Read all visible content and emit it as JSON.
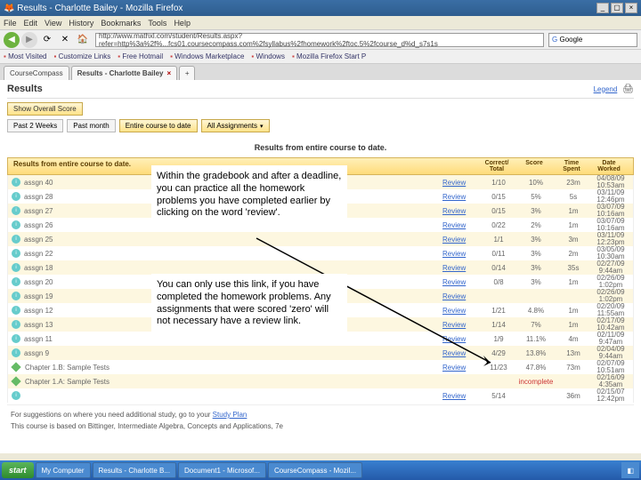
{
  "window": {
    "title": "Results - Charlotte Bailey - Mozilla Firefox"
  },
  "menu": [
    "File",
    "Edit",
    "View",
    "History",
    "Bookmarks",
    "Tools",
    "Help"
  ],
  "url": "http://www.mathxl.com/student/Results.aspx?refer=http%3a%2f%...fcs01.coursecompass.com%2fsyllabus%2fhomework%2ftoc.5%2fcourse_d%d_s7s1s",
  "search_placeholder": "Google",
  "bookmarks": [
    "Most Visited",
    "Customize Links",
    "Free Hotmail",
    "Windows Marketplace",
    "Windows",
    "Mozilla Firefox Start P"
  ],
  "tabs": [
    {
      "label": "CourseCompass"
    },
    {
      "label": "Results - Charlotte Bailey",
      "active": true
    }
  ],
  "page": {
    "heading": "Results",
    "legend": "Legend",
    "score_btn": "Show Overall Score",
    "filters": [
      {
        "label": "Past 2 Weeks"
      },
      {
        "label": "Past month"
      },
      {
        "label": "Entire course to date",
        "active": true
      },
      {
        "label": "All Assignments",
        "dropdown": true
      }
    ],
    "section_title": "Results from entire course to date.",
    "results_header": "Results from entire course to date.",
    "cols": {
      "review": "",
      "correct": "Correct/\nTotal",
      "score": "Score",
      "time": "Time\nSpent",
      "date": "Date\nWorked"
    }
  },
  "rows": [
    {
      "name": "assgn 40",
      "review": "Review",
      "correct": "1/10",
      "score": "10%",
      "time": "23m",
      "date": "04/08/09\n10:53am"
    },
    {
      "name": "assgn 28",
      "review": "Review",
      "correct": "0/15",
      "score": "5%",
      "time": "5s",
      "date": "03/11/09\n12:46pm"
    },
    {
      "name": "assgn 27",
      "review": "Review",
      "correct": "0/15",
      "score": "3%",
      "time": "1m",
      "date": "03/07/09\n10:16am"
    },
    {
      "name": "assgn 26",
      "review": "Review",
      "correct": "0/22",
      "score": "2%",
      "time": "1m",
      "date": "03/07/09\n10:16am"
    },
    {
      "name": "assgn 25",
      "review": "Review",
      "correct": "1/1",
      "score": "3%",
      "time": "3m",
      "date": "03/11/09\n12:23pm"
    },
    {
      "name": "assgn 22",
      "review": "Review",
      "correct": "0/11",
      "score": "3%",
      "time": "2m",
      "date": "03/05/09\n10:30am"
    },
    {
      "name": "assgn 18",
      "review": "Review",
      "correct": "0/14",
      "score": "3%",
      "time": "35s",
      "date": "02/27/09\n9:44am"
    },
    {
      "name": "assgn 20",
      "review": "Review",
      "correct": "0/8",
      "score": "3%",
      "time": "1m",
      "date": "02/26/09\n1:02pm"
    },
    {
      "name": "assgn 19",
      "review": "Review",
      "correct": "",
      "score": "",
      "time": "",
      "date": "02/26/09\n1:02pm"
    },
    {
      "name": "assgn 12",
      "review": "Review",
      "correct": "1/21",
      "score": "4.8%",
      "time": "1m",
      "date": "02/20/09\n11:55am"
    },
    {
      "name": "assgn 13",
      "review": "Review",
      "correct": "1/14",
      "score": "7%",
      "time": "1m",
      "date": "02/17/09\n10:42am"
    },
    {
      "name": "assgn 11",
      "review": "Review",
      "correct": "1/9",
      "score": "11.1%",
      "time": "4m",
      "date": "02/11/09\n9:47am"
    },
    {
      "name": "assgn 9",
      "review": "Review",
      "correct": "4/29",
      "score": "13.8%",
      "time": "13m",
      "date": "02/04/09\n9:44am"
    },
    {
      "name": "Chapter 1.B: Sample Tests",
      "review": "Review",
      "correct": "11/23",
      "score": "47.8%",
      "time": "73m",
      "date": "02/07/09\n10:51am",
      "diamond": true
    },
    {
      "name": "Chapter 1.A: Sample Tests",
      "review": "",
      "correct": "",
      "score": "incomplete",
      "time": "",
      "date": "02/16/09\n4:35am",
      "diamond": true,
      "incomplete": true
    },
    {
      "name": "",
      "review": "Review",
      "correct": "5/14",
      "score": "",
      "time": "36m",
      "date": "02/15/07\n12:42pm",
      "extra": true
    }
  ],
  "callouts": {
    "a": "Within the gradebook and after a deadline, you can practice all the homework problems you have completed earlier by clicking on the word 'review'.",
    "b": "You can only use this link, if you have completed the homework problems.  Any assignments that were scored 'zero' will not necessary have a review link."
  },
  "footer": {
    "suggest": "For suggestions on where you need additional study, go to your ",
    "link": "Study Plan",
    "course": "This course is based on Bittinger, Intermediate Algebra, Concepts and Applications, 7e"
  },
  "taskbar": {
    "start": "start",
    "items": [
      "My Computer",
      "Results - Charlotte B...",
      "Document1 - Microsof...",
      "CourseCompass - Mozil..."
    ]
  }
}
